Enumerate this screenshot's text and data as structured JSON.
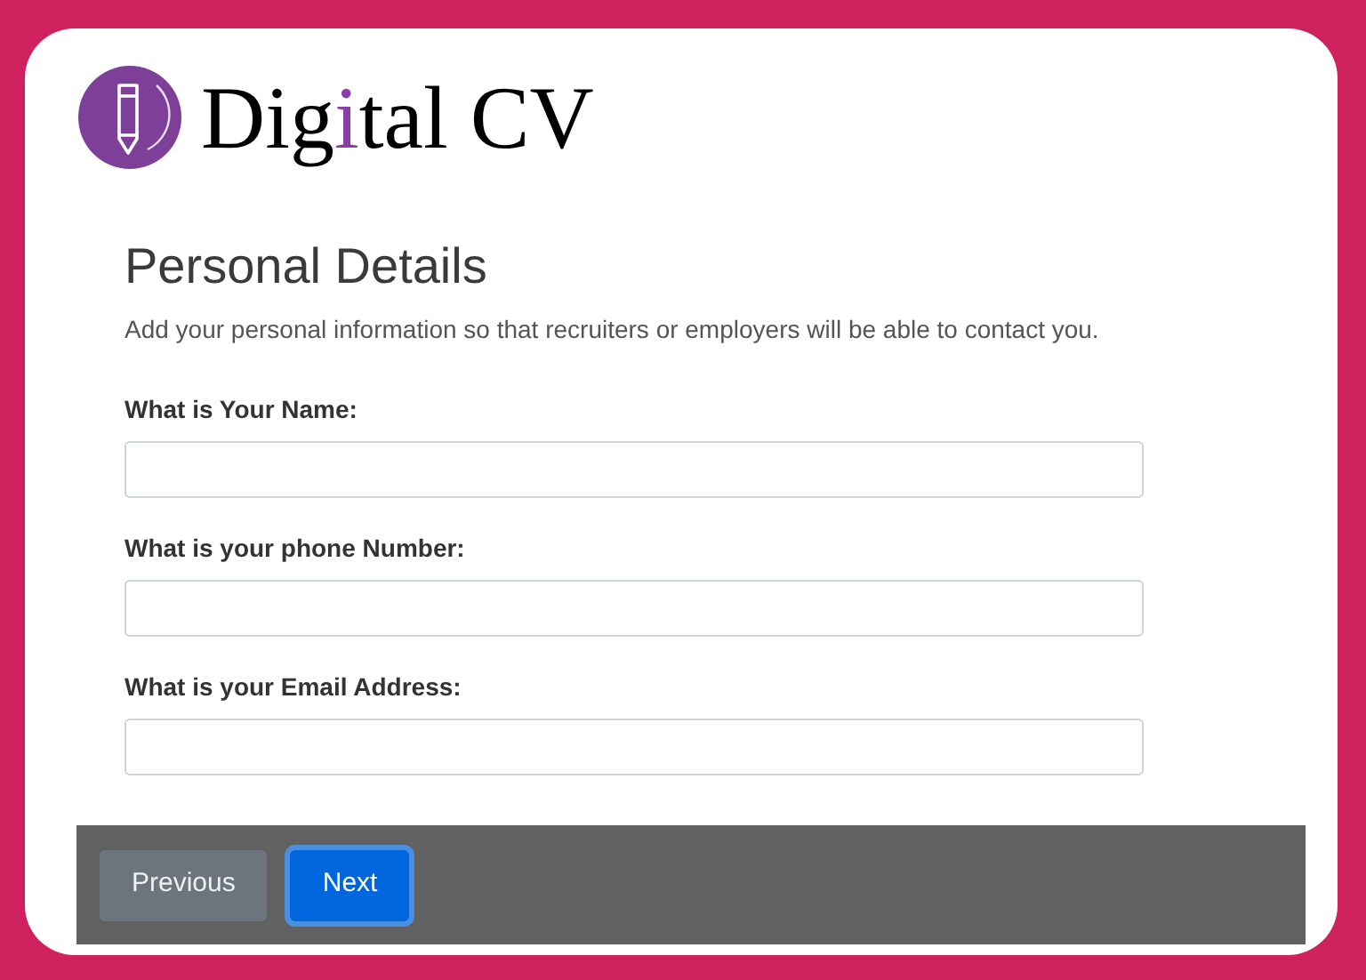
{
  "logo": {
    "parts": [
      {
        "text": "Dig",
        "accent": false
      },
      {
        "text": "i",
        "accent": true
      },
      {
        "text": "tal CV",
        "accent": false
      }
    ]
  },
  "heading": "Personal Details",
  "description": "Add your personal information so that recruiters or employers will be able to contact you.",
  "fields": [
    {
      "label": "What is Your Name:"
    },
    {
      "label": "What is your phone Number:"
    },
    {
      "label": "What is your Email Address:"
    }
  ],
  "buttons": [
    {
      "label": "Previous",
      "kind": "secondary",
      "focused": false
    },
    {
      "label": "Next",
      "kind": "primary",
      "focused": true
    }
  ]
}
